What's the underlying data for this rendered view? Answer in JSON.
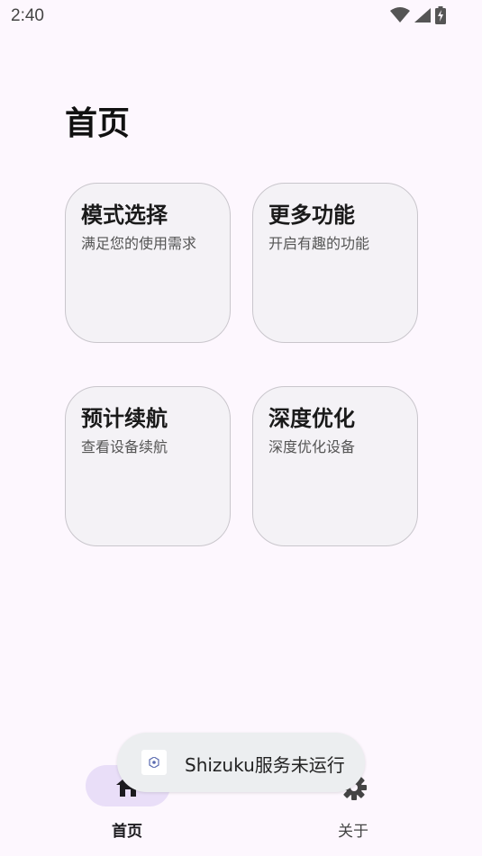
{
  "status_bar": {
    "time": "2:40",
    "icons": [
      "wifi-icon",
      "cellular-icon",
      "battery-charging-icon"
    ]
  },
  "page": {
    "title": "首页"
  },
  "cards": [
    {
      "title": "模式选择",
      "desc": "满足您的使用需求"
    },
    {
      "title": "更多功能",
      "desc": "开启有趣的功能"
    },
    {
      "title": "预计续航",
      "desc": "查看设备续航"
    },
    {
      "title": "深度优化",
      "desc": "深度优化设备"
    }
  ],
  "toast": {
    "text": "Shizuku服务未运行",
    "icon": "shizuku-app-icon"
  },
  "bottom_nav": {
    "items": [
      {
        "label": "首页",
        "icon": "home-icon",
        "selected": true
      },
      {
        "label": "关于",
        "icon": "gear-icon",
        "selected": false
      }
    ]
  },
  "colors": {
    "background": "#fdf7fe",
    "card_bg": "#f4f2f6",
    "card_border": "#c9c6cc",
    "nav_selected_pill": "#e9def8",
    "toast_bg": "#eceef0"
  }
}
